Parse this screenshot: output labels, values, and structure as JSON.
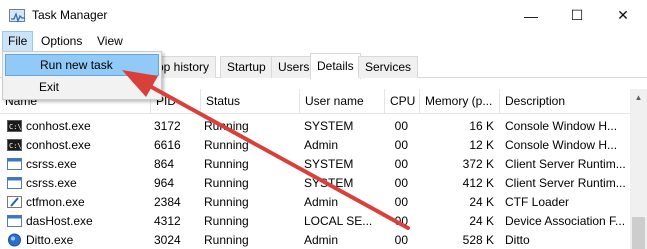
{
  "window": {
    "title": "Task Manager",
    "minimize_glyph": "—",
    "maximize_glyph": "☐",
    "close_glyph": "✕"
  },
  "menu": {
    "file": "File",
    "options": "Options",
    "view": "View"
  },
  "file_menu": {
    "run_new_task": "Run new task",
    "exit": "Exit"
  },
  "tabs": [
    {
      "label": "pp history"
    },
    {
      "label": "Startup"
    },
    {
      "label": "Users"
    },
    {
      "label": "Details",
      "active": true
    },
    {
      "label": "Services"
    }
  ],
  "columns": {
    "name": "Name",
    "pid": "PID",
    "status": "Status",
    "user": "User name",
    "cpu": "CPU",
    "memory": "Memory (p...",
    "description": "Description"
  },
  "processes": [
    {
      "name": "conhost.exe",
      "pid": "3172",
      "status": "Running",
      "user": "SYSTEM",
      "cpu": "00",
      "memory": "16 K",
      "description": "Console Window H...",
      "icon": "console-icon"
    },
    {
      "name": "conhost.exe",
      "pid": "6616",
      "status": "Running",
      "user": "Admin",
      "cpu": "00",
      "memory": "12 K",
      "description": "Console Window H...",
      "icon": "console-icon"
    },
    {
      "name": "csrss.exe",
      "pid": "864",
      "status": "Running",
      "user": "SYSTEM",
      "cpu": "00",
      "memory": "372 K",
      "description": "Client Server Runtim...",
      "icon": "window-app-icon"
    },
    {
      "name": "csrss.exe",
      "pid": "964",
      "status": "Running",
      "user": "SYSTEM",
      "cpu": "00",
      "memory": "412 K",
      "description": "Client Server Runtim...",
      "icon": "window-app-icon"
    },
    {
      "name": "ctfmon.exe",
      "pid": "2384",
      "status": "Running",
      "user": "Admin",
      "cpu": "00",
      "memory": "24 K",
      "description": "CTF Loader",
      "icon": "ctf-pen-icon"
    },
    {
      "name": "dasHost.exe",
      "pid": "4312",
      "status": "Running",
      "user": "LOCAL SE...",
      "cpu": "00",
      "memory": "24 K",
      "description": "Device Association F...",
      "icon": "window-app-icon"
    },
    {
      "name": "Ditto.exe",
      "pid": "3024",
      "status": "Running",
      "user": "Admin",
      "cpu": "00",
      "memory": "528 K",
      "description": "Ditto",
      "icon": "ditto-globe-icon"
    }
  ],
  "colors": {
    "menu_highlight": "#cce4f7",
    "dropdown_highlight": "#91c9f7",
    "arrow": "#d9403a"
  }
}
